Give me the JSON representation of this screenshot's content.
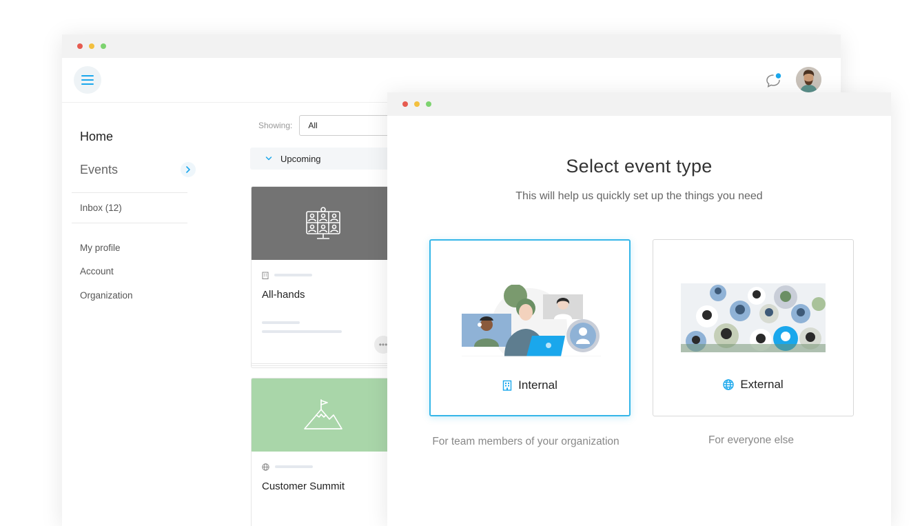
{
  "window_controls": {
    "close": "#e65b50",
    "minimize": "#f3c03f",
    "maximize": "#7dd36f"
  },
  "sidebar": {
    "home": "Home",
    "events": "Events",
    "inbox": "Inbox (12)",
    "my_profile": "My profile",
    "account": "Account",
    "organization": "Organization"
  },
  "filter": {
    "label": "Showing:",
    "value": "All"
  },
  "upcoming_label": "Upcoming",
  "cards": [
    {
      "title": "All-hands",
      "hero_color": "#737373",
      "icon": "video-conference-icon",
      "meta_icon": "building-icon"
    },
    {
      "title": "Customer Summit",
      "hero_color": "#a9d6a9",
      "icon": "mountain-flag-icon",
      "meta_icon": "globe-icon"
    }
  ],
  "modal": {
    "title": "Select event type",
    "subtitle": "This will help us quickly set up the things you need",
    "options": [
      {
        "label": "Internal",
        "icon": "building-icon",
        "description": "For team members of your organization",
        "selected": true
      },
      {
        "label": "External",
        "icon": "globe-icon",
        "description": "For everyone else",
        "selected": false
      }
    ]
  },
  "colors": {
    "accent": "#35b6e8",
    "notification": "#1aa7ec"
  }
}
